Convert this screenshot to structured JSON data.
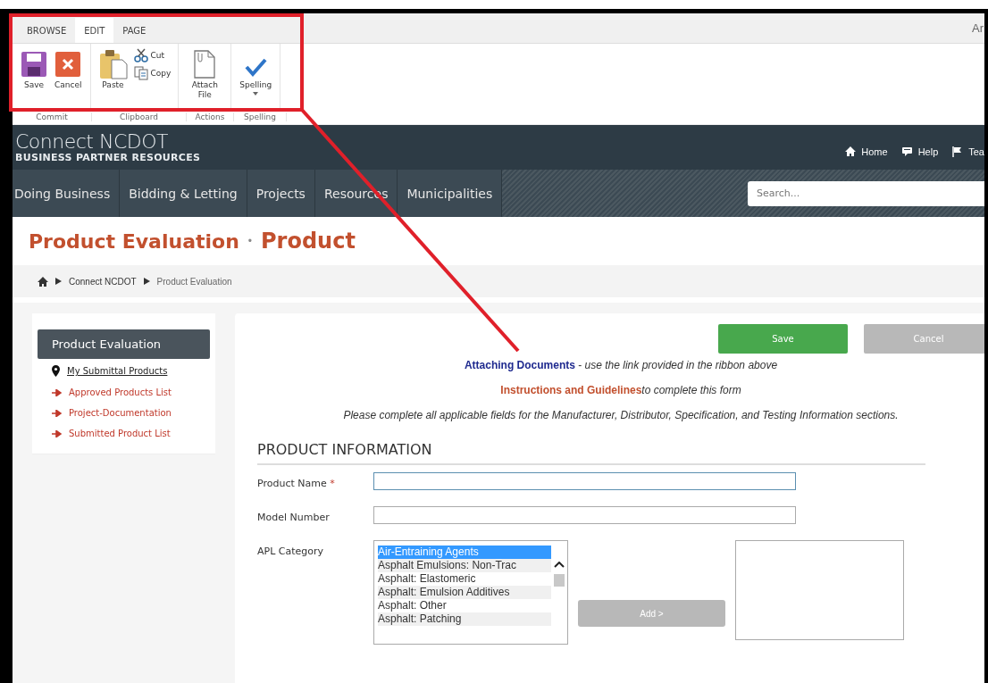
{
  "ribbon": {
    "tabs": [
      {
        "label": "BROWSE",
        "selected": false
      },
      {
        "label": "EDIT",
        "selected": true
      },
      {
        "label": "PAGE",
        "selected": false
      }
    ],
    "user_name": "Ar",
    "groups": [
      {
        "label": "Commit",
        "buttons": [
          {
            "label": "Save",
            "kind": "large"
          },
          {
            "label": "Cancel",
            "kind": "large"
          }
        ]
      },
      {
        "label": "Clipboard",
        "buttons": [
          {
            "label": "Paste",
            "kind": "large"
          },
          {
            "label": "Cut",
            "kind": "small"
          },
          {
            "label": "Copy",
            "kind": "small"
          }
        ]
      },
      {
        "label": "Actions",
        "buttons": [
          {
            "label": "Attach File",
            "kind": "large"
          }
        ]
      },
      {
        "label": "Spelling",
        "buttons": [
          {
            "label": "Spelling",
            "kind": "menu"
          }
        ]
      }
    ]
  },
  "header": {
    "title": "Connect NCDOT",
    "subtitle": "BUSINESS PARTNER RESOURCES",
    "links": [
      "Home",
      "Help",
      "Tea"
    ]
  },
  "nav": {
    "items": [
      "Doing Business",
      "Bidding & Letting",
      "Projects",
      "Resources",
      "Municipalities"
    ],
    "search": {
      "placeholder": "Search..."
    }
  },
  "page_title": {
    "parent": "Product Evaluation",
    "separator": "•",
    "current": "Product"
  },
  "breadcrumb": [
    "Connect NCDOT",
    "Product Evaluation"
  ],
  "sidebar": {
    "title": "Product Evaluation",
    "items": [
      {
        "label": "My Submittal Products",
        "selected": true
      },
      {
        "label": "Approved Products List",
        "selected": false
      },
      {
        "label": "Project-Documentation",
        "selected": false
      },
      {
        "label": "Submitted Product List",
        "selected": false
      }
    ]
  },
  "main": {
    "buttons": [
      {
        "label": "Save",
        "kind": "primary"
      },
      {
        "label": "Cancel",
        "kind": "secondary"
      }
    ],
    "notes": [
      {
        "link": "Attaching Documents",
        "text": " - *use the link provided in the ribbon above*",
        "kind": "blue"
      },
      {
        "link": "Instructions and Guidelines",
        "text": "*to complete this form*",
        "kind": "orange"
      },
      {
        "text": "Please complete all applicable fields for the Manufacturer, Distributor, Specification, and Testing Information sections.",
        "kind": "plain"
      }
    ],
    "section": "PRODUCT INFORMATION",
    "fields": [
      {
        "label": "Product Name",
        "required_mark": "*",
        "kind": "text",
        "focused": true
      },
      {
        "label": "Model Number",
        "kind": "text",
        "focused": false
      },
      {
        "label": "APL Category",
        "kind": "picker",
        "add_button": "Add >",
        "options": [
          {
            "label": "Air-Entraining Agents",
            "selected": true
          },
          {
            "label": "Asphalt Emulsions: Non-Trac",
            "selected": false
          },
          {
            "label": "Asphalt: Elastomeric",
            "selected": false
          },
          {
            "label": "Asphalt: Emulsion Additives",
            "selected": false
          },
          {
            "label": "Asphalt: Other",
            "selected": false
          },
          {
            "label": "Asphalt: Patching",
            "selected": false
          }
        ]
      }
    ]
  }
}
